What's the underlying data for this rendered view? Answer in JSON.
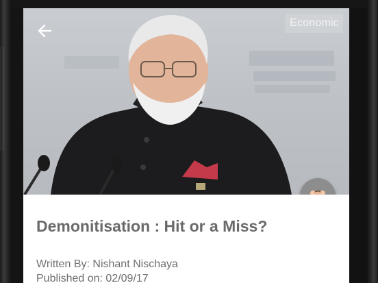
{
  "header": {
    "back_icon": "arrow-left-icon",
    "category": "Economic"
  },
  "hero": {
    "image_description_icon": "portrait-photo"
  },
  "fab": {
    "icon": "people-group-icon"
  },
  "article": {
    "title": "Demonitisation : Hit or a Miss?",
    "author_line": "Written By: Nishant Nischaya",
    "published_line": "Published on: 02/09/17"
  },
  "colors": {
    "title": "#6a6a6a",
    "meta": "#6e6e6e",
    "fab": "#8d8d8d",
    "pocket_square": "#c43a4a",
    "jacket": "#1c1c1e"
  }
}
